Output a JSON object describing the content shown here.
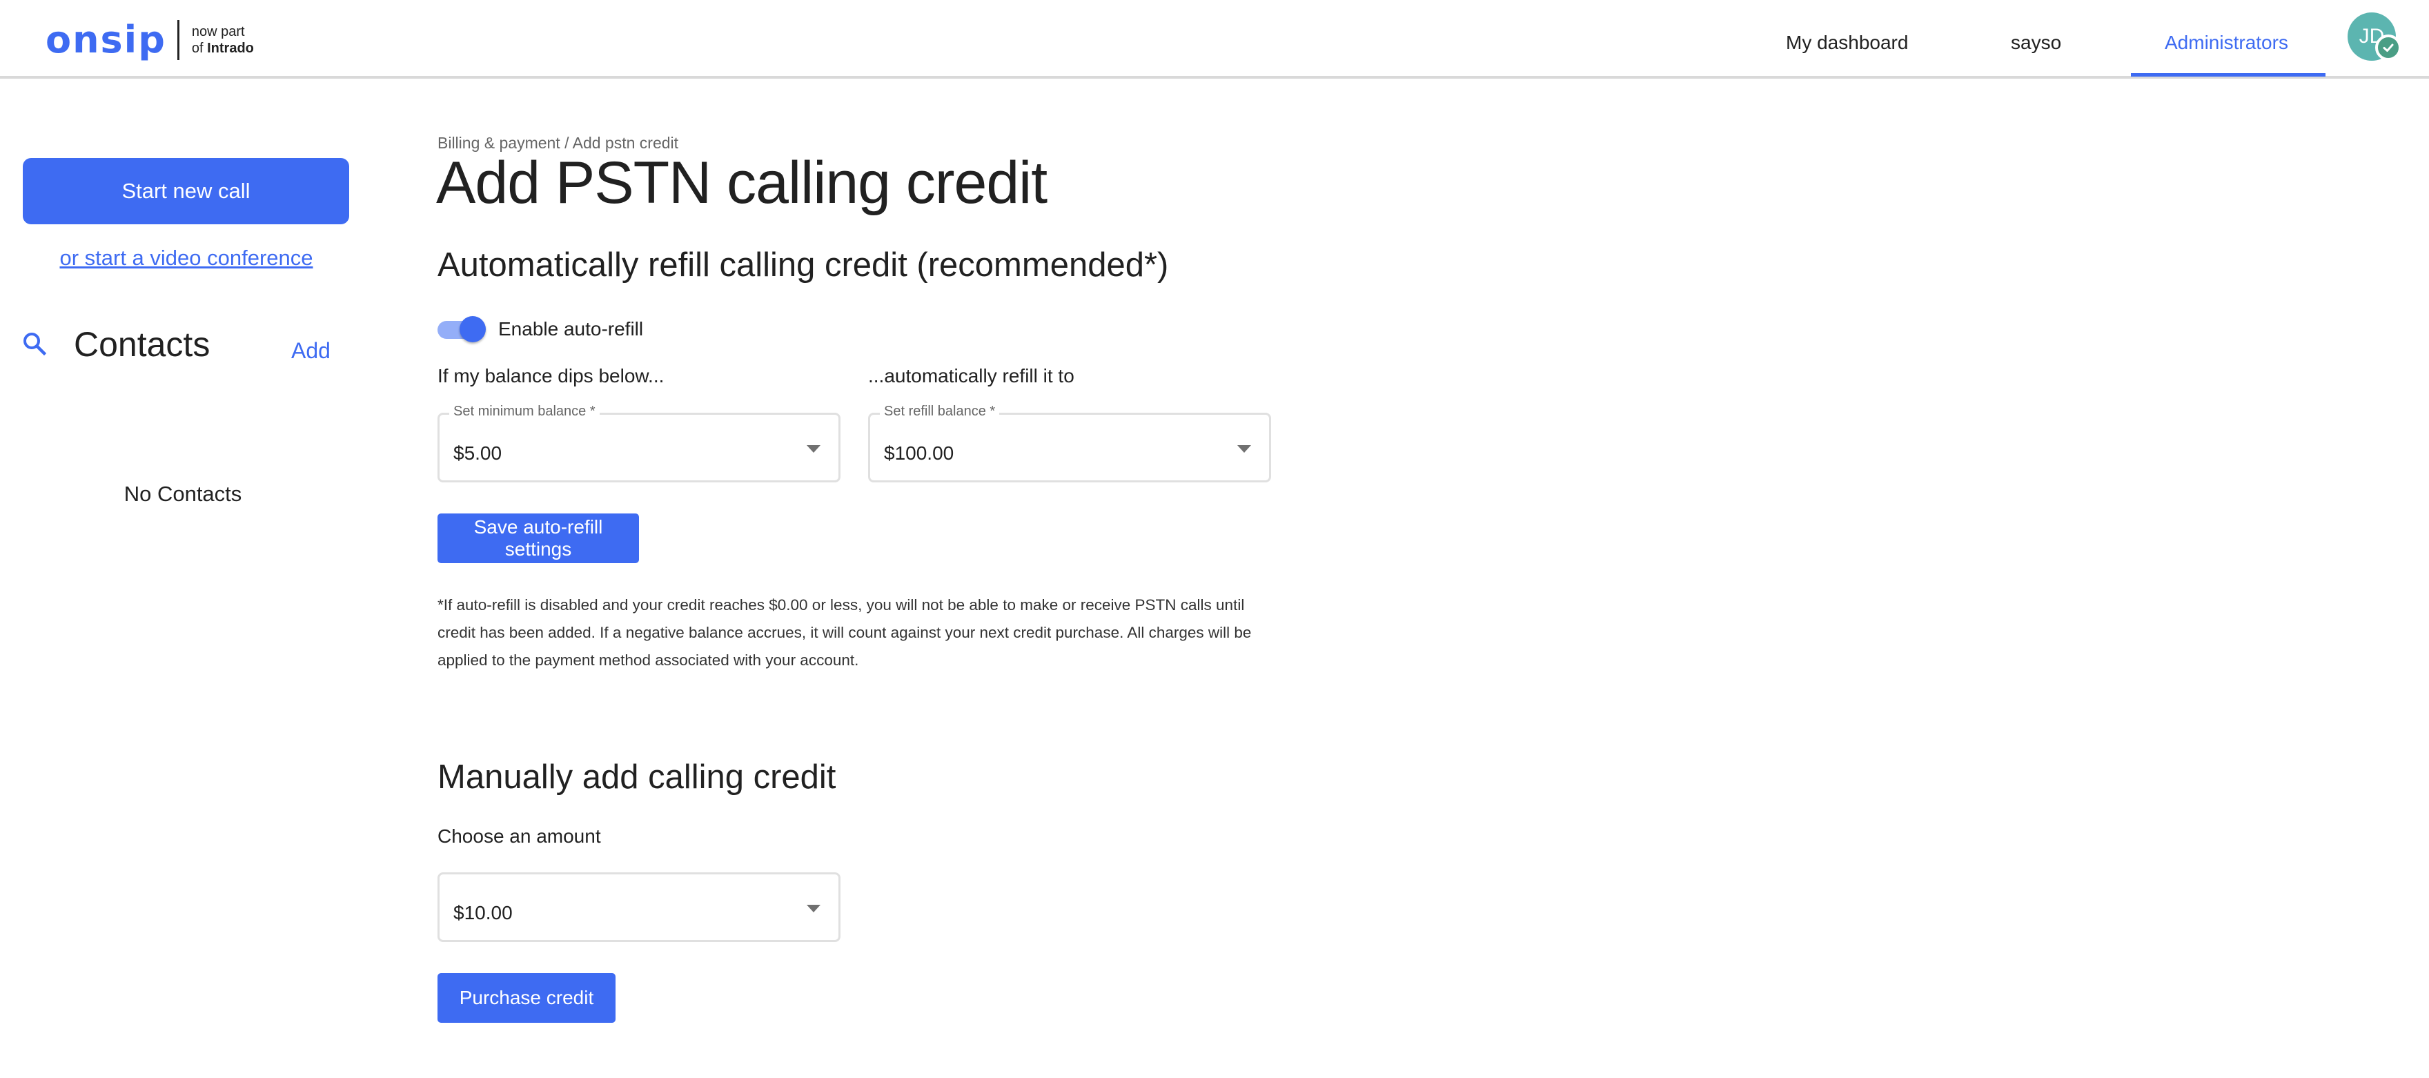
{
  "header": {
    "logo": {
      "word": "onsip",
      "sub_line1": "now part",
      "sub_line2_prefix": "of ",
      "sub_line2_brand": "Intrado"
    },
    "nav": [
      {
        "label": "My dashboard",
        "active": false
      },
      {
        "label": "sayso",
        "active": false
      },
      {
        "label": "Administrators",
        "active": true
      }
    ],
    "avatar": {
      "initials": "JD",
      "status_icon": "check-icon",
      "color": "#5cb5b0"
    }
  },
  "sidebar": {
    "start_call_label": "Start new call",
    "video_conference_link": "or start a video conference",
    "contacts_title": "Contacts",
    "contacts_add": "Add",
    "search_icon": "search-icon",
    "empty_state": "No Contacts"
  },
  "main": {
    "breadcrumb": "Billing & payment / Add pstn credit",
    "title": "Add PSTN calling credit",
    "auto_refill": {
      "heading": "Automatically refill calling credit (recommended*)",
      "toggle_label": "Enable auto-refill",
      "toggle_on": true,
      "min_label": "If my balance dips below...",
      "refill_label": "...automatically refill it to",
      "min_select": {
        "legend": "Set minimum balance *",
        "value": "$5.00"
      },
      "refill_select": {
        "legend": "Set refill balance *",
        "value": "$100.00"
      },
      "save_button": "Save auto-refill settings",
      "footnote": "*If auto-refill is disabled and your credit reaches $0.00 or less, you will not be able to make or receive PSTN calls until credit has been added. If a negative balance accrues, it will count against your next credit purchase. All charges will be applied to the payment method associated with your account."
    },
    "manual": {
      "heading": "Manually add calling credit",
      "choose_label": "Choose an amount",
      "amount_select": {
        "value": "$10.00"
      },
      "purchase_button": "Purchase credit"
    }
  },
  "colors": {
    "accent": "#3e6bf2",
    "toggle_track": "#94aef8",
    "avatar": "#5cb5b0",
    "avatar_badge": "#4a9e85"
  }
}
